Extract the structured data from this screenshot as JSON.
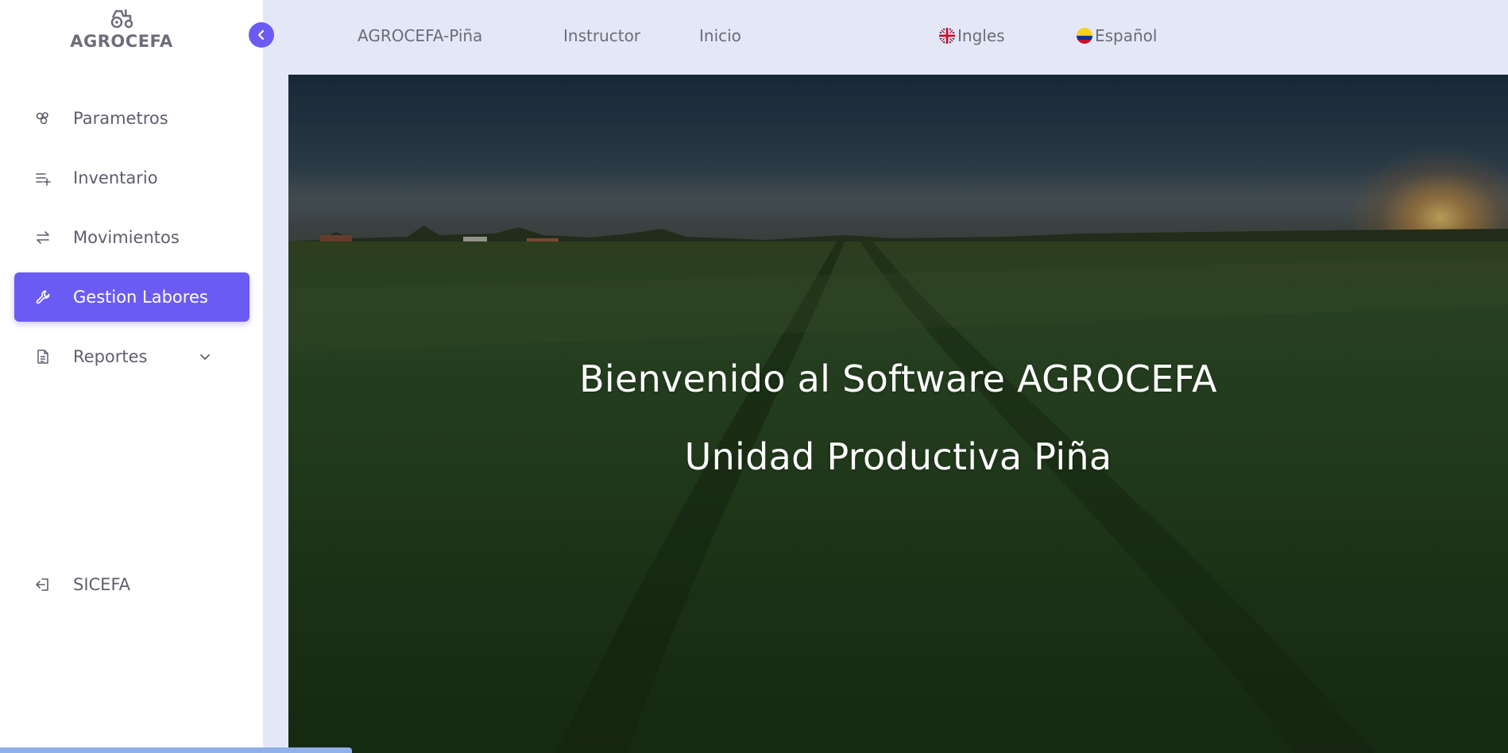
{
  "colors": {
    "accent": "#6a5cf3",
    "sidebar_bg": "#ffffff",
    "topbar_bg": "#e4e8f6",
    "text_muted": "#6b6b7a"
  },
  "brand": {
    "name": "AGROCEFA",
    "icon": "tractor-icon"
  },
  "sidebar": {
    "items": [
      {
        "label": "Parametros",
        "icon": "parameters-icon"
      },
      {
        "label": "Inventario",
        "icon": "list-add-icon"
      },
      {
        "label": "Movimientos",
        "icon": "swap-arrows-icon"
      },
      {
        "label": "Gestion Labores",
        "icon": "wrench-icon",
        "active": true
      },
      {
        "label": "Reportes",
        "icon": "document-icon",
        "has_dropdown": true
      }
    ],
    "footer_item": {
      "label": "SICEFA",
      "icon": "logout-icon"
    }
  },
  "topnav": {
    "unit_link": "AGROCEFA-Piña",
    "role_link": "Instructor",
    "home_link": "Inicio",
    "lang_english": "Ingles",
    "lang_spanish": "Español",
    "notifications_icon": "bell-icon"
  },
  "hero": {
    "title": "Bienvenido al Software AGROCEFA",
    "subtitle": "Unidad Productiva Piña"
  }
}
